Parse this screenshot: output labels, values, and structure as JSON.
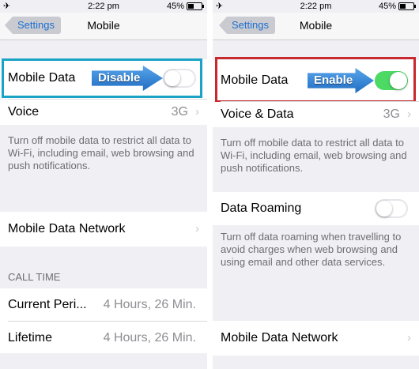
{
  "left": {
    "status": {
      "time": "2:22 pm",
      "battery": "45%",
      "battery_level": 0.45
    },
    "nav": {
      "back_label": "Settings",
      "title": "Mobile"
    },
    "mobile_data": {
      "label": "Mobile Data",
      "callout": "Disable",
      "enabled": false
    },
    "voice": {
      "label": "Voice",
      "value": "3G"
    },
    "footer": "Turn off mobile data to restrict all data to Wi-Fi, including email, web browsing and push notifications.",
    "network": {
      "label": "Mobile Data Network"
    },
    "call_time": {
      "header": "CALL TIME",
      "current": {
        "label": "Current Peri...",
        "value": "4 Hours, 26 Min."
      },
      "lifetime": {
        "label": "Lifetime",
        "value": "4 Hours, 26 Min."
      }
    },
    "highlight_color": "#1ba3c6"
  },
  "right": {
    "status": {
      "time": "2:22 pm",
      "battery": "45%",
      "battery_level": 0.45
    },
    "nav": {
      "back_label": "Settings",
      "title": "Mobile"
    },
    "mobile_data": {
      "label": "Mobile Data",
      "callout": "Enable",
      "enabled": true
    },
    "voice_data": {
      "label": "Voice & Data",
      "value": "3G"
    },
    "footer": "Turn off mobile data to restrict all data to Wi-Fi, including email, web browsing and push notifications.",
    "roaming": {
      "label": "Data Roaming",
      "enabled": false
    },
    "roaming_footer": "Turn off data roaming when travelling to avoid charges when web browsing and using email and other data services.",
    "network": {
      "label": "Mobile Data Network"
    },
    "highlight_color": "#c8282e"
  },
  "colors": {
    "toggle_on": "#4cd964",
    "link": "#1e6fd0",
    "arrow": "#2f80d6"
  }
}
